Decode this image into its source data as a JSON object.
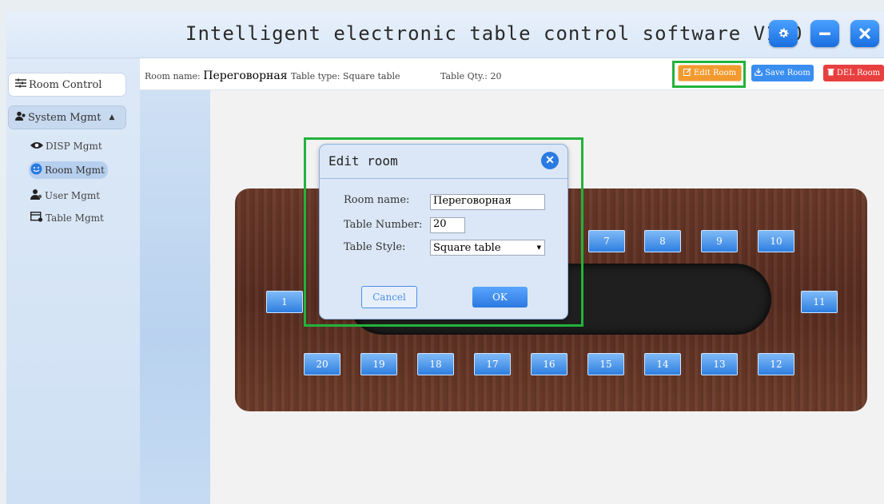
{
  "app": {
    "title": "Intelligent electronic table control software V1.0",
    "window_buttons": [
      "gear-icon",
      "minimize-icon",
      "close-icon"
    ]
  },
  "sidebar": {
    "room_control": "Room Control",
    "system_mgmt": "System Mgmt",
    "items": [
      {
        "label": "DISP Mgmt",
        "icon": "eye-icon"
      },
      {
        "label": "Room Mgmt",
        "icon": "smile-icon"
      },
      {
        "label": "User Mgmt",
        "icon": "user-icon"
      },
      {
        "label": "Table Mgmt",
        "icon": "table-icon"
      }
    ]
  },
  "infobar": {
    "room_name_label": "Room name:",
    "room_name_value": "Переговорная",
    "table_type_label": "Table type:",
    "table_type_value": "Square table",
    "table_qty_label": "Table Qty.:",
    "table_qty_value": "20"
  },
  "toolbar": {
    "edit_room": "Edit Room",
    "save_room": "Save Room",
    "del_room": "DEL Room"
  },
  "seats": {
    "left": "1",
    "top": [
      "7",
      "8",
      "9",
      "10"
    ],
    "right": "11",
    "bottom": [
      "20",
      "19",
      "18",
      "17",
      "16",
      "15",
      "14",
      "13",
      "12"
    ]
  },
  "dialog": {
    "title": "Edit room",
    "room_name_label": "Room name:",
    "room_name_value": "Переговорная",
    "table_number_label": "Table Number:",
    "table_number_value": "20",
    "table_style_label": "Table Style:",
    "table_style_value": "Square table",
    "cancel": "Cancel",
    "ok": "OK"
  },
  "colors": {
    "accent_blue": "#2b79e0",
    "edit_orange": "#f29a2e",
    "del_red": "#e8403f",
    "highlight_green": "#22b33a"
  }
}
